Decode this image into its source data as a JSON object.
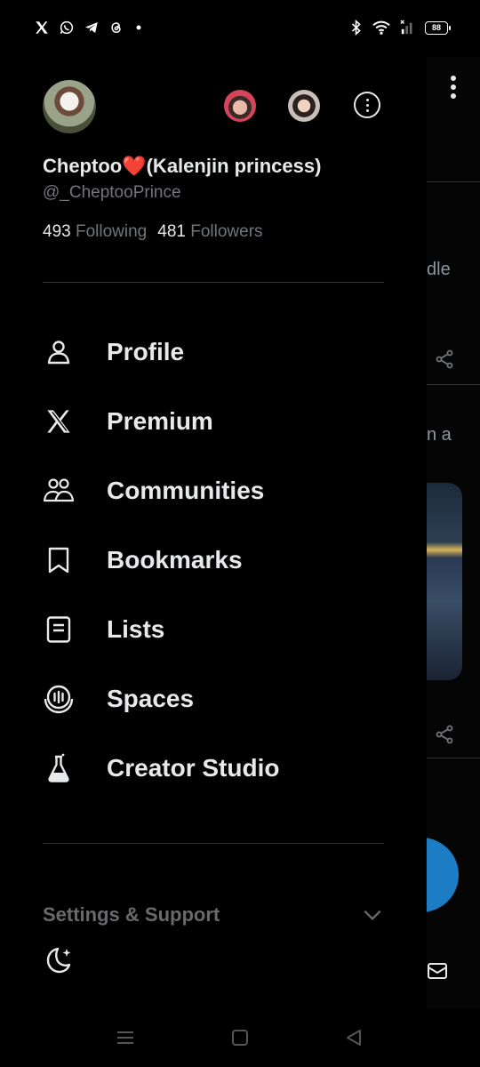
{
  "status_bar": {
    "left_icons": [
      "x-logo-icon",
      "whatsapp-icon",
      "telegram-icon",
      "threads-icon",
      "dot-icon"
    ],
    "right_icons": [
      "bluetooth-icon",
      "wifi-icon",
      "signal-icon"
    ],
    "battery": "88"
  },
  "profile": {
    "display_name": "Cheptoo",
    "name_emoji": "❤️",
    "name_suffix": "(Kalenjin princess)",
    "handle": "@_CheptooPrince",
    "following_count": "493",
    "following_label": "Following",
    "followers_count": "481",
    "followers_label": "Followers"
  },
  "menu": {
    "items": [
      {
        "label": "Profile",
        "icon": "person-icon"
      },
      {
        "label": "Premium",
        "icon": "x-logo-icon"
      },
      {
        "label": "Communities",
        "icon": "communities-icon"
      },
      {
        "label": "Bookmarks",
        "icon": "bookmark-icon"
      },
      {
        "label": "Lists",
        "icon": "list-icon"
      },
      {
        "label": "Spaces",
        "icon": "spaces-icon"
      },
      {
        "label": "Creator Studio",
        "icon": "flask-icon"
      }
    ]
  },
  "settings": {
    "label": "Settings & Support",
    "theme_icon": "moon-icon"
  },
  "feed_fragments": {
    "frag1": "dle",
    "frag2": "n a"
  },
  "nav_bar": {
    "icons": [
      "recents-icon",
      "home-icon",
      "back-icon"
    ]
  }
}
